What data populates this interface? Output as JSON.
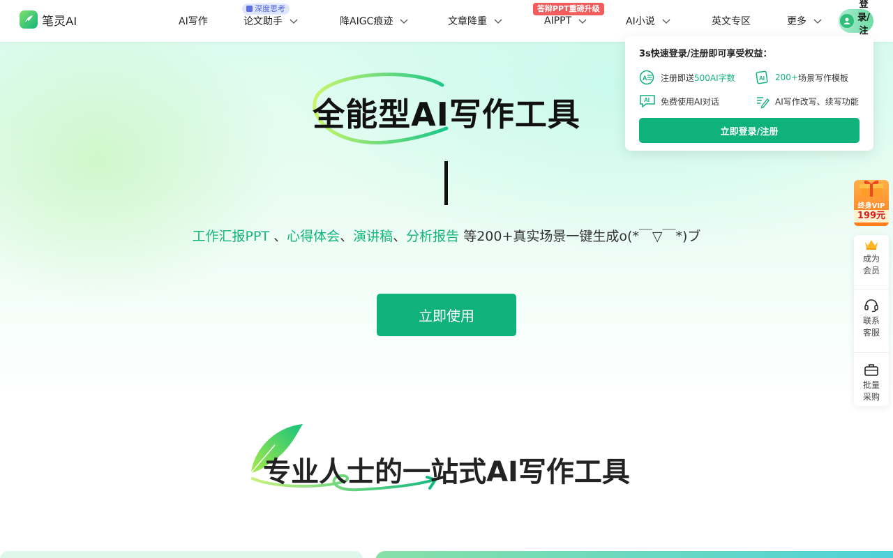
{
  "header": {
    "logo_text": "笔灵AI",
    "nav": [
      {
        "label": "AI写作"
      },
      {
        "label": "论文助手",
        "badge": "深度思考"
      },
      {
        "label": "降AIGC痕迹"
      },
      {
        "label": "文章降重"
      },
      {
        "label": "AIPPT",
        "badge": "答辩PPT重磅升级"
      },
      {
        "label": "AI小说"
      },
      {
        "label": "英文专区"
      },
      {
        "label": "更多"
      }
    ],
    "login_label": "登录/注"
  },
  "popup": {
    "title": "3s快速登录/注册即可享受权益：",
    "benefits": [
      {
        "pre": "注册即送",
        "highlight": "500AI字数",
        "post": "",
        "icon": "ai-text-icon"
      },
      {
        "pre": "",
        "highlight": "200+",
        "post": "场景写作模板",
        "icon": "template-icon"
      },
      {
        "pre": "免费使用AI对话",
        "highlight": "",
        "post": "",
        "icon": "ai-chat-icon"
      },
      {
        "pre": "AI写作改写、续写功能",
        "highlight": "",
        "post": "",
        "icon": "rewrite-icon"
      }
    ],
    "button": "立即登录/注册"
  },
  "hero": {
    "title": "全能型AI写作工具",
    "subtitle_parts": {
      "g1": "工作汇报PPT",
      "s1": " 、",
      "g2": "心得体会",
      "s2": "、",
      "g3": "演讲稿",
      "s3": "、",
      "g4": "分析报告",
      "tail": " 等200+真实场景一键生成o(*￣▽￣*)ブ"
    },
    "cta": "立即使用"
  },
  "section": {
    "title": "专业人士的一站式AI写作工具"
  },
  "side": {
    "vip_title": "终身VIP",
    "vip_price": "199元",
    "items": [
      {
        "label1": "成为",
        "label2": "会员",
        "icon": "crown-icon"
      },
      {
        "label1": "联系",
        "label2": "客服",
        "icon": "headset-icon"
      },
      {
        "label1": "批量",
        "label2": "采购",
        "icon": "briefcase-icon"
      }
    ]
  },
  "colors": {
    "brand": "#0fb27a",
    "badge_red": "#f25c5c",
    "badge_blue": "#4d63d8"
  }
}
